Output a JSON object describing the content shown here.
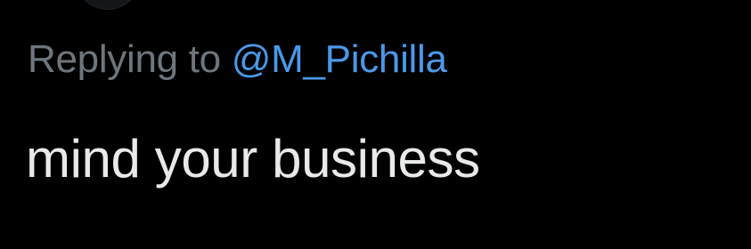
{
  "reply": {
    "prefix": "Replying to",
    "mention": "@M_Pichilla"
  },
  "tweet": {
    "text": "mind your business"
  },
  "colors": {
    "background": "#000000",
    "muted_text": "#6e767d",
    "link": "#4a99e9",
    "body_text": "#e7e9ea"
  }
}
